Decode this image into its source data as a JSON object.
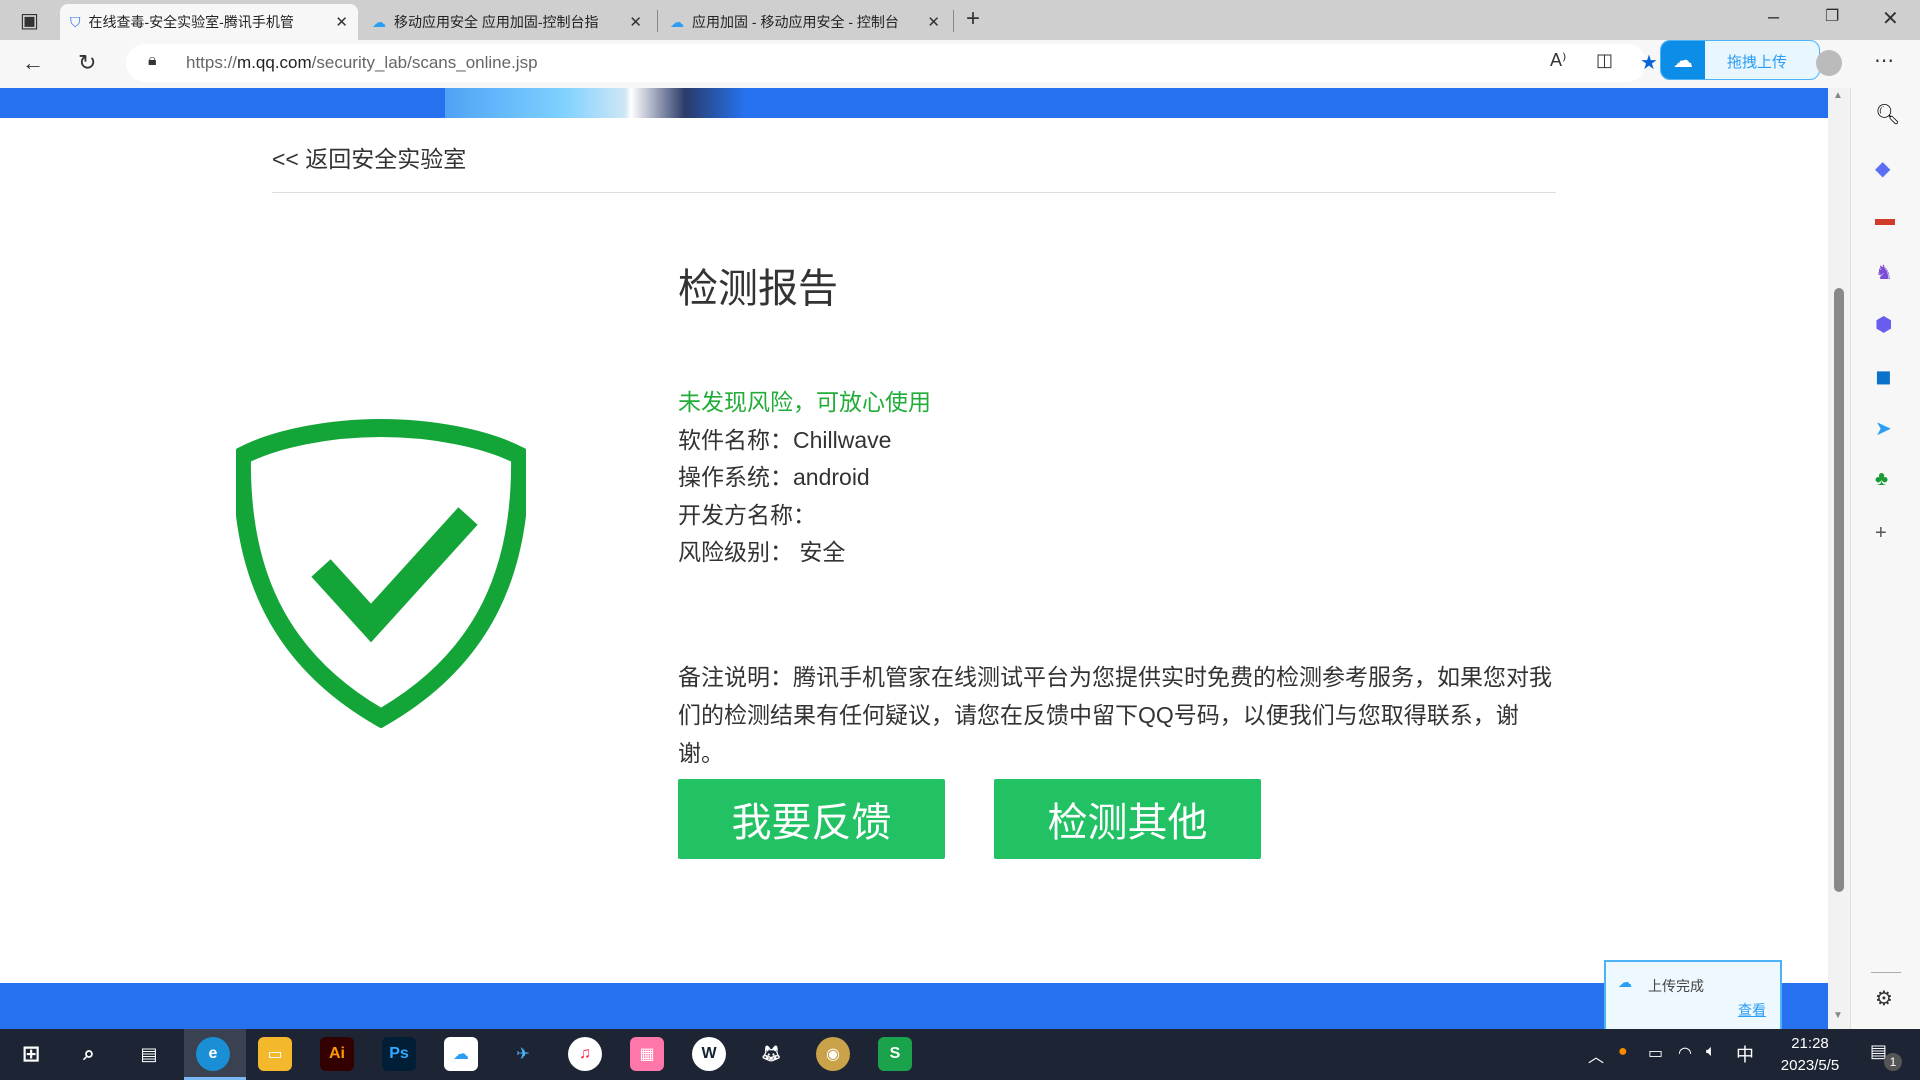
{
  "browser": {
    "tabs": [
      {
        "title": "在线查毒-安全实验室-腾讯手机管",
        "icon": "shield-icon",
        "active": true
      },
      {
        "title": "移动应用安全 应用加固-控制台指",
        "icon": "cloud-icon",
        "active": false
      },
      {
        "title": "应用加固 - 移动应用安全 - 控制台",
        "icon": "cloud-icon",
        "active": false
      }
    ],
    "url_prefix": "https://",
    "url_domain": "m.qq.com",
    "url_path": "/security_lab/scans_online.jsp",
    "upload_button": "拖拽上传"
  },
  "page": {
    "back_link": "<< 返回安全实验室",
    "title": "检测报告",
    "status": "未发现风险，可放心使用",
    "software_name": "软件名称：Chillwave",
    "os": "操作系统：android",
    "developer": "开发方名称：",
    "risk_level": "风险级别： 安全",
    "note": "备注说明：腾讯手机管家在线测试平台为您提供实时免费的检测参考服务，如果您对我们的检测结果有任何疑议，请您在反馈中留下QQ号码，以便我们与您取得联系，谢谢。",
    "feedback_button": "我要反馈",
    "scan_other_button": "检测其他",
    "status_color": "#22ac38",
    "button_color": "#21c164"
  },
  "popup": {
    "text": "上传完成",
    "link": "查看"
  },
  "taskbar": {
    "time": "21:28",
    "date": "2023/5/5",
    "ime": "中",
    "notifications": "1"
  }
}
